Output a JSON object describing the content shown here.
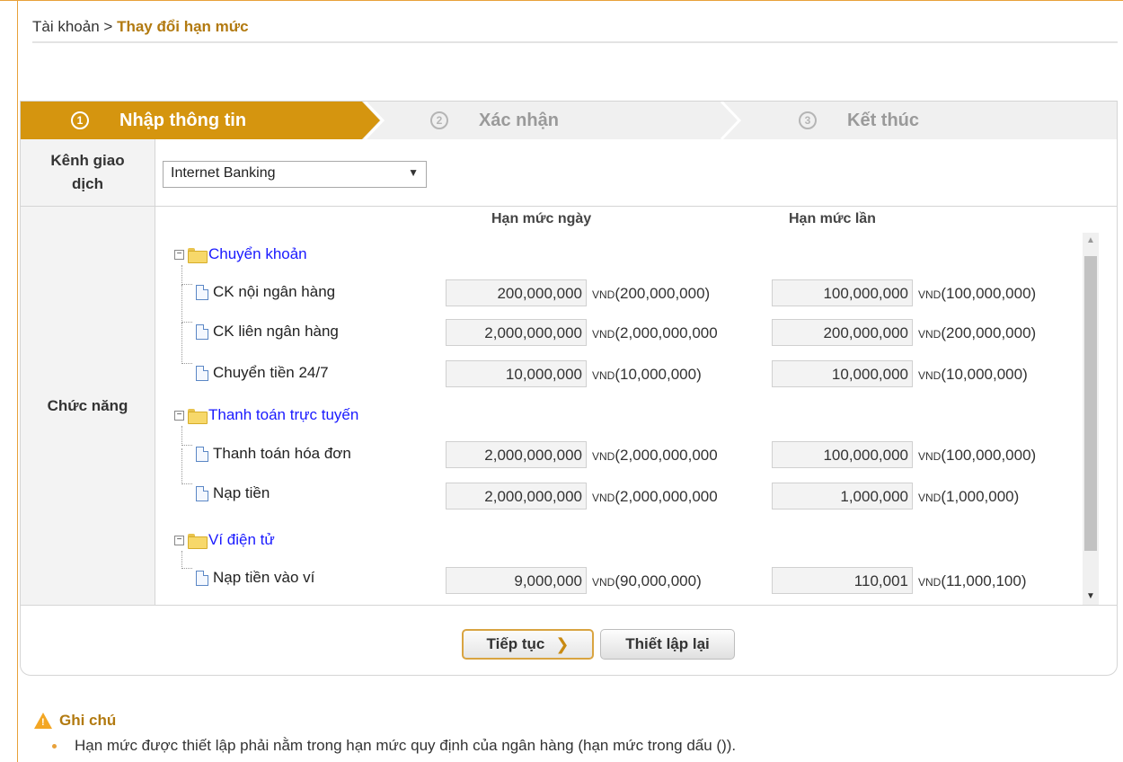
{
  "breadcrumb": {
    "parent": "Tài khoản",
    "separator": ">",
    "current": "Thay đổi hạn mức"
  },
  "steps": [
    {
      "number": "1",
      "label": "Nhập thông tin",
      "state": "active"
    },
    {
      "number": "2",
      "label": "Xác nhận",
      "state": "inactive"
    },
    {
      "number": "3",
      "label": "Kết thúc",
      "state": "inactive"
    }
  ],
  "channel": {
    "label": "Kênh giao dịch",
    "selected": "Internet Banking"
  },
  "function": {
    "label": "Chức năng",
    "col_daily": "Hạn mức ngày",
    "col_per_tx": "Hạn mức lần",
    "groups": [
      {
        "name": "Chuyển khoản",
        "items": [
          {
            "name": "CK nội ngân hàng",
            "daily": "200,000,000",
            "daily_max": "(200,000,000)",
            "per_tx": "100,000,000",
            "per_tx_max": "(100,000,000)"
          },
          {
            "name": "CK liên ngân hàng",
            "daily": "2,000,000,000",
            "daily_max": "(2,000,000,000",
            "per_tx": "200,000,000",
            "per_tx_max": "(200,000,000)"
          },
          {
            "name": "Chuyển tiền 24/7",
            "daily": "10,000,000",
            "daily_max": "(10,000,000)",
            "per_tx": "10,000,000",
            "per_tx_max": "(10,000,000)"
          }
        ]
      },
      {
        "name": "Thanh toán trực tuyến",
        "items": [
          {
            "name": "Thanh toán hóa đơn",
            "daily": "2,000,000,000",
            "daily_max": "(2,000,000,000",
            "per_tx": "100,000,000",
            "per_tx_max": "(100,000,000)"
          },
          {
            "name": "Nạp tiền",
            "daily": "2,000,000,000",
            "daily_max": "(2,000,000,000",
            "per_tx": "1,000,000",
            "per_tx_max": "(1,000,000)"
          }
        ]
      },
      {
        "name": "Ví điện tử",
        "items": [
          {
            "name": "Nạp tiền vào ví",
            "daily": "9,000,000",
            "daily_max": "(90,000,000)",
            "per_tx": "110,001",
            "per_tx_max": "(11,000,100)"
          }
        ]
      }
    ],
    "unit": "VND"
  },
  "buttons": {
    "next": "Tiếp tục",
    "reset": "Thiết lập lại"
  },
  "notes": {
    "title": "Ghi chú",
    "items": [
      "Hạn mức được thiết lập phải nằm trong hạn mức quy định của ngân hàng (hạn mức trong dấu ())."
    ]
  },
  "colors": {
    "accent": "#d5950f",
    "link": "#1a1aff",
    "brand_text": "#b27a10"
  }
}
